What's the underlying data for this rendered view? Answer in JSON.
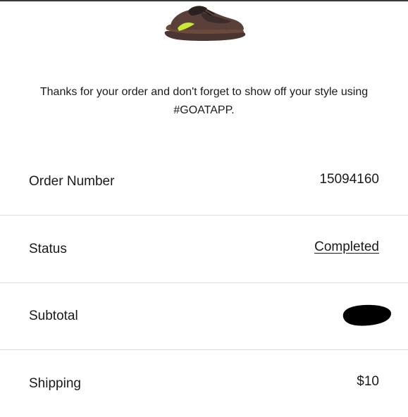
{
  "product": {
    "image_icon": "sneaker-product-image",
    "colors": {
      "upper": "#5a4038",
      "sole": "#6b4a3c",
      "accent": "#c8e836",
      "dark": "#2a2220"
    }
  },
  "confirmation": {
    "message_line1": "Thanks for your order and don't forget to show off your style using",
    "message_line2": "#GOATAPP."
  },
  "order_details": {
    "order_number": {
      "label": "Order Number",
      "value": "15094160"
    },
    "status": {
      "label": "Status",
      "value": "Completed"
    },
    "subtotal": {
      "label": "Subtotal",
      "value_redacted": true
    },
    "shipping": {
      "label": "Shipping",
      "value": "$10"
    }
  },
  "colors": {
    "divider": "#dcdcdc",
    "text": "#1a1a1a",
    "redaction": "#000000"
  }
}
